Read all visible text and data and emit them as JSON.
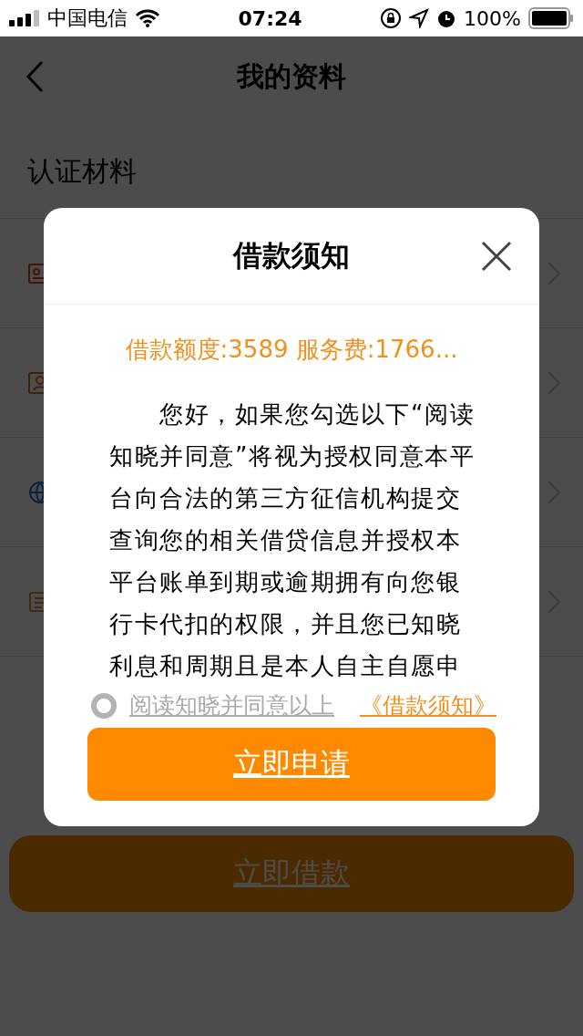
{
  "status_bar": {
    "carrier": "中国电信",
    "time": "07:24",
    "battery": "100%"
  },
  "nav": {
    "title": "我的资料"
  },
  "section_title": "认证材料",
  "rows": [
    {
      "kind": "id-card"
    },
    {
      "kind": "profile-card"
    },
    {
      "kind": "globe"
    },
    {
      "kind": "document"
    }
  ],
  "primary_button": "立即借款",
  "dialog": {
    "title": "借款须知",
    "summary": "借款额度:3589 服务费:1766...",
    "body": "您好，如果您勾选以下“阅读知晓并同意”将视为授权同意本平台向合法的第三方征信机构提交查询您的相关借贷信息并授权本平台账单到期或逾期拥有向您银行卡代扣的权限，并且您已知晓利息和周期且是本人自主自愿申",
    "agreement": {
      "checked": false,
      "label": "阅读知晓并同意以上",
      "link": "《借款须知》"
    },
    "button": "立即申请"
  }
}
